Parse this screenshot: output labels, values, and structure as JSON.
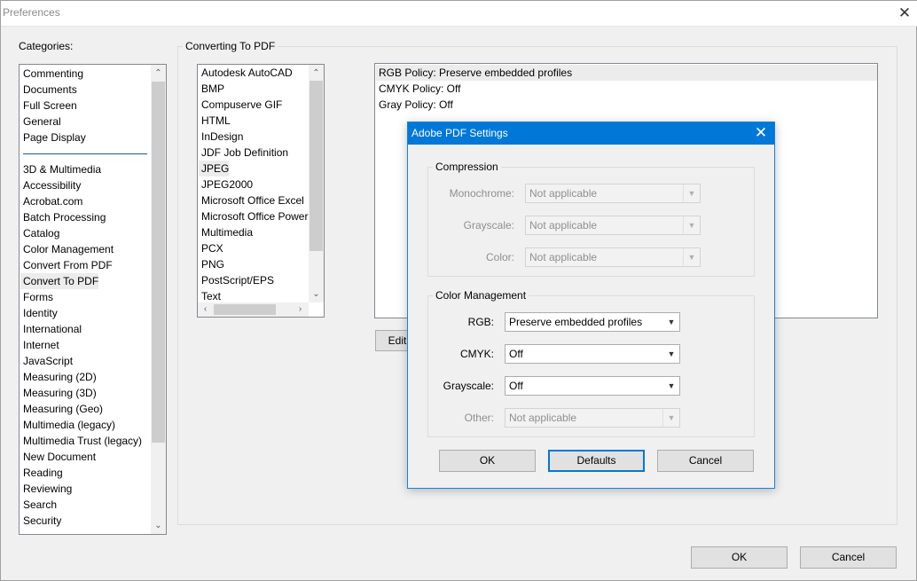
{
  "window": {
    "title": "Preferences",
    "close_icon": "close-icon"
  },
  "categories": {
    "label": "Categories:",
    "top_items": [
      "Commenting",
      "Documents",
      "Full Screen",
      "General",
      "Page Display"
    ],
    "items": [
      "3D & Multimedia",
      "Accessibility",
      "Acrobat.com",
      "Batch Processing",
      "Catalog",
      "Color Management",
      "Convert From PDF",
      "Convert To PDF",
      "Forms",
      "Identity",
      "International",
      "Internet",
      "JavaScript",
      "Measuring (2D)",
      "Measuring (3D)",
      "Measuring (Geo)",
      "Multimedia (legacy)",
      "Multimedia Trust (legacy)",
      "New Document",
      "Reading",
      "Reviewing",
      "Search",
      "Security"
    ],
    "selected": "Convert To PDF"
  },
  "panel": {
    "title": "Converting To PDF",
    "formats": [
      "Autodesk AutoCAD",
      "BMP",
      "Compuserve GIF",
      "HTML",
      "InDesign",
      "JDF Job Definition",
      "JPEG",
      "JPEG2000",
      "Microsoft Office Excel",
      "Microsoft Office PowerPoint",
      "Multimedia",
      "PCX",
      "PNG",
      "PostScript/EPS",
      "Text"
    ],
    "selected_format": "JPEG",
    "settings_lines": [
      "RGB Policy: Preserve embedded profiles",
      "CMYK Policy: Off",
      "Gray Policy: Off"
    ],
    "edit_button": "Edit"
  },
  "dialog": {
    "title": "Adobe PDF Settings",
    "compression": {
      "legend": "Compression",
      "rows": [
        {
          "label": "Monochrome:",
          "value": "Not applicable"
        },
        {
          "label": "Grayscale:",
          "value": "Not applicable"
        },
        {
          "label": "Color:",
          "value": "Not applicable"
        }
      ]
    },
    "color_management": {
      "legend": "Color Management",
      "rows": [
        {
          "label": "RGB:",
          "value": "Preserve embedded profiles"
        },
        {
          "label": "CMYK:",
          "value": "Off"
        },
        {
          "label": "Grayscale:",
          "value": "Off"
        },
        {
          "label": "Other:",
          "value": "Not applicable"
        }
      ]
    },
    "ok_button": "OK",
    "defaults_button": "Defaults",
    "cancel_button": "Cancel"
  },
  "footer": {
    "ok_button": "OK",
    "cancel_button": "Cancel"
  },
  "colors": {
    "accent": "#0078d7",
    "selection": "#ececec"
  }
}
